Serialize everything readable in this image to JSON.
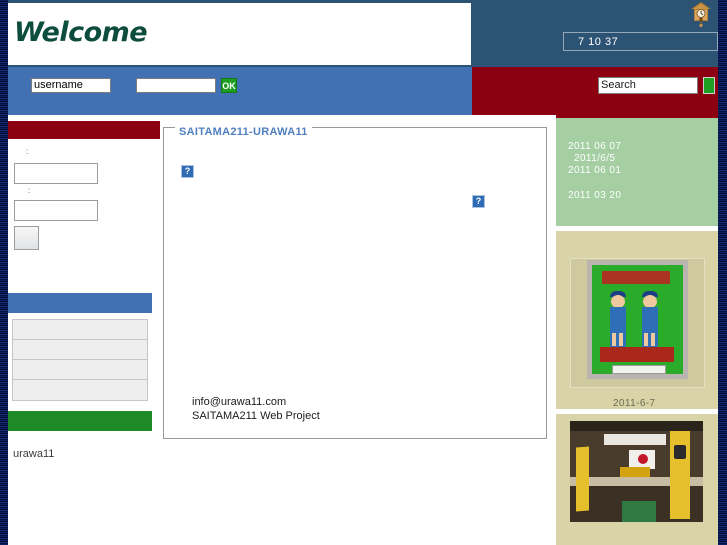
{
  "header": {
    "welcome_title": "Welcome",
    "clock_icon": "cuckoo-clock-icon",
    "time_display": "7 10 37"
  },
  "loginbar": {
    "username_value": "username",
    "password_value": "",
    "ok_label": "OK",
    "search_value": "Search",
    "search_go_label": ""
  },
  "sidebar_left": {
    "login_panel_header": "",
    "user_label": ":",
    "pass_label": ":",
    "user_input_value": "",
    "pass_input_value": "",
    "submit_label": "",
    "menu_header": "",
    "menu_rows": [
      "",
      "",
      "",
      ""
    ],
    "menu_footer": "",
    "site_name": "urawa11"
  },
  "main": {
    "legend": "SAITAMA211-URAWA11",
    "broken_image_1": "broken-image-icon",
    "broken_image_2": "broken-image-icon",
    "broken_glyph": "?",
    "contact_email": "info@urawa11.com",
    "contact_org": "SAITAMA211 Web Project"
  },
  "sidebar_right": {
    "news_dates": [
      "2011 06 07",
      "2011/6/5",
      "2011 06 01",
      "2011 03 20"
    ],
    "photo_1_caption": "2011-6-7",
    "photo_1_alt": "childrens-poster-drawing",
    "photo_2_alt": "boy-scouts-ceremony-photo"
  },
  "colors": {
    "header_blue": "#2d5374",
    "login_blue": "#4170b3",
    "dark_red": "#8c0011",
    "green": "#1f8a28",
    "news_green": "#a5cfa3",
    "photo_tan": "#d9d4a8",
    "legend_blue": "#4f7fbf",
    "welcome_green": "#0d4d3d"
  }
}
